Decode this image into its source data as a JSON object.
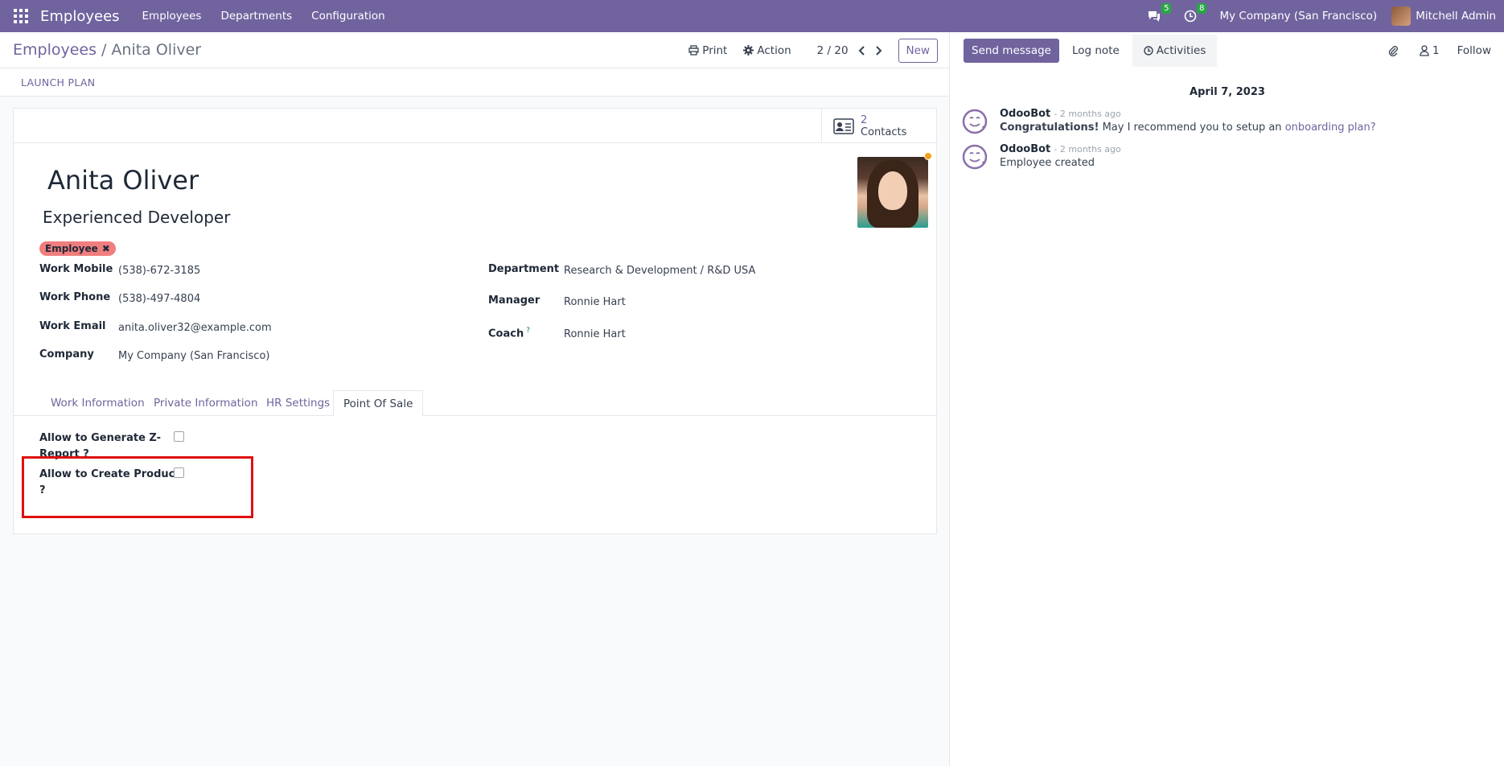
{
  "navbar": {
    "brand": "Employees",
    "menus": [
      "Employees",
      "Departments",
      "Configuration"
    ],
    "messages_count": "5",
    "activities_count": "8",
    "company": "My Company (San Francisco)",
    "user": "Mitchell Admin"
  },
  "control_panel": {
    "breadcrumb_parent": "Employees",
    "breadcrumb_sep": "/",
    "breadcrumb_current": "Anita Oliver",
    "print_label": "Print",
    "action_label": "Action",
    "pager": "2 / 20",
    "new_label": "New"
  },
  "statusbar": {
    "launch_plan": "LAUNCH PLAN"
  },
  "smart_button": {
    "count": "2",
    "label": "Contacts"
  },
  "employee": {
    "name": "Anita Oliver",
    "job_title": "Experienced Developer",
    "tag": "Employee"
  },
  "fields": {
    "work_mobile_label": "Work Mobile",
    "work_mobile": "(538)-672-3185",
    "work_phone_label": "Work Phone",
    "work_phone": "(538)-497-4804",
    "work_email_label": "Work Email",
    "work_email": "anita.oliver32@example.com",
    "company_label": "Company",
    "company": "My Company (San Francisco)",
    "department_label": "Department",
    "department": "Research & Development / R&D USA",
    "manager_label": "Manager",
    "manager": "Ronnie Hart",
    "coach_label": "Coach",
    "coach_help": "?",
    "coach": "Ronnie Hart"
  },
  "tabs": [
    "Work Information",
    "Private Information",
    "HR Settings",
    "Point Of Sale"
  ],
  "pos": {
    "z_report_label_1": "Allow to Generate Z-",
    "z_report_label_2": "Report ?",
    "create_product_label_1": "Allow to Create Product",
    "create_product_label_2": "?"
  },
  "chatter": {
    "send_message": "Send message",
    "log_note": "Log note",
    "activities": "Activities",
    "followers_count": "1",
    "follow": "Follow",
    "date": "April 7, 2023",
    "messages": [
      {
        "author": "OdooBot",
        "date": "- 2 months ago",
        "body_bold": "Congratulations!",
        "body": " May I recommend you to setup an ",
        "link": "onboarding plan?"
      },
      {
        "author": "OdooBot",
        "date": "- 2 months ago",
        "body": "Employee created"
      }
    ]
  },
  "colors": {
    "brand": "#71639e",
    "tag": "#f07e7e",
    "highlight": "#e01010",
    "badge": "#28a745"
  }
}
